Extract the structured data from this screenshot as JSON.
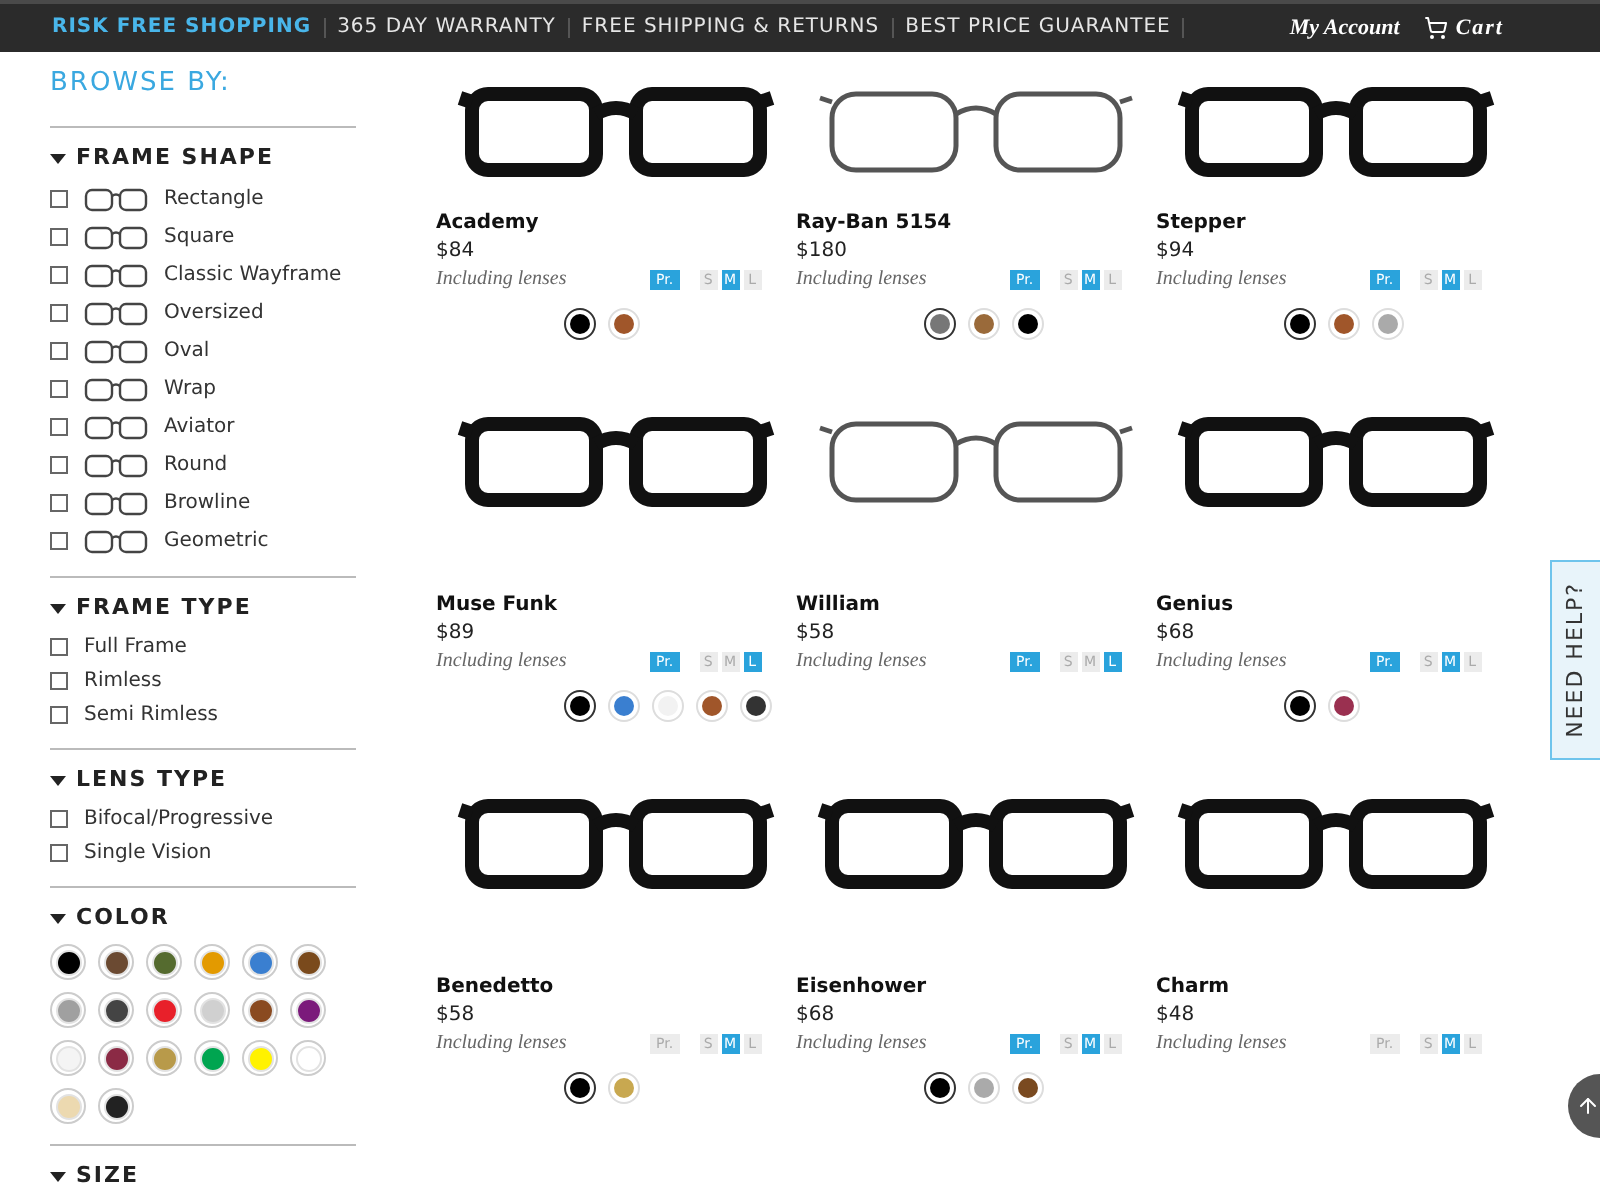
{
  "top_bar": {
    "promos": [
      {
        "label": "RISK FREE SHOPPING",
        "highlight": true
      },
      {
        "label": "365 DAY WARRANTY",
        "highlight": false
      },
      {
        "label": "FREE SHIPPING & RETURNS",
        "highlight": false
      },
      {
        "label": "BEST PRICE GUARANTEE",
        "highlight": false
      }
    ],
    "account": "My Account",
    "cart": "Cart"
  },
  "sidebar": {
    "title": "BROWSE BY:",
    "sections": [
      {
        "title": "FRAME SHAPE",
        "expanded": true,
        "kind": "shapes",
        "options": [
          {
            "label": "Rectangle",
            "checked": false
          },
          {
            "label": "Square",
            "checked": false
          },
          {
            "label": "Classic Wayframe",
            "checked": false
          },
          {
            "label": "Oversized",
            "checked": false
          },
          {
            "label": "Oval",
            "checked": false
          },
          {
            "label": "Wrap",
            "checked": false
          },
          {
            "label": "Aviator",
            "checked": false
          },
          {
            "label": "Round",
            "checked": false
          },
          {
            "label": "Browline",
            "checked": false
          },
          {
            "label": "Geometric",
            "checked": false
          }
        ]
      },
      {
        "title": "FRAME TYPE",
        "expanded": true,
        "kind": "checks",
        "options": [
          {
            "label": "Full Frame",
            "checked": false
          },
          {
            "label": "Rimless",
            "checked": false
          },
          {
            "label": "Semi Rimless",
            "checked": false
          }
        ]
      },
      {
        "title": "LENS TYPE",
        "expanded": true,
        "kind": "checks",
        "options": [
          {
            "label": "Bifocal/Progressive",
            "checked": false
          },
          {
            "label": "Single Vision",
            "checked": false
          }
        ]
      },
      {
        "title": "COLOR",
        "expanded": true,
        "kind": "colors",
        "options": [
          {
            "color": "#000000"
          },
          {
            "color": "#6b4a32"
          },
          {
            "color": "#556b2f"
          },
          {
            "color": "#e39a00"
          },
          {
            "color": "#3a7fd0"
          },
          {
            "color": "#7a4a1c"
          },
          {
            "color": "#a0a0a0"
          },
          {
            "color": "#444444"
          },
          {
            "color": "#e8202a"
          },
          {
            "color": "#d0d0d0"
          },
          {
            "color": "#8a4a20"
          },
          {
            "color": "#7b1a7b"
          },
          {
            "color": "#f4f4f4"
          },
          {
            "color": "#8b2a45"
          },
          {
            "color": "#b89a4a"
          },
          {
            "color": "#00a550"
          },
          {
            "color": "#fff200"
          },
          {
            "color": "#ffffff"
          },
          {
            "color": "#ecd9b0"
          },
          {
            "color": "#222222"
          }
        ]
      },
      {
        "title": "SIZE",
        "expanded": true,
        "kind": "checks"
      }
    ]
  },
  "products": [
    {
      "name": "Academy",
      "price": "$84",
      "note": "Including lenses",
      "progressive": "Pr.",
      "progressive_available": true,
      "sizes": [
        {
          "label": "S",
          "selected": false
        },
        {
          "label": "M",
          "selected": true
        },
        {
          "label": "L",
          "selected": false
        }
      ],
      "swatches": [
        {
          "color": "#000000",
          "selected": true
        },
        {
          "color": "#a0562a",
          "selected": false
        }
      ]
    },
    {
      "name": "Ray-Ban 5154",
      "price": "$180",
      "note": "Including lenses",
      "progressive": "Pr.",
      "progressive_available": true,
      "sizes": [
        {
          "label": "S",
          "selected": false
        },
        {
          "label": "M",
          "selected": true
        },
        {
          "label": "L",
          "selected": false
        }
      ],
      "swatches": [
        {
          "color": "#777777",
          "selected": true
        },
        {
          "color": "#9a6a3a",
          "selected": false
        },
        {
          "color": "#000000",
          "selected": false
        }
      ]
    },
    {
      "name": "Stepper",
      "price": "$94",
      "note": "Including lenses",
      "progressive": "Pr.",
      "progressive_available": true,
      "sizes": [
        {
          "label": "S",
          "selected": false
        },
        {
          "label": "M",
          "selected": true
        },
        {
          "label": "L",
          "selected": false
        }
      ],
      "swatches": [
        {
          "color": "#000000",
          "selected": true
        },
        {
          "color": "#a0562a",
          "selected": false
        },
        {
          "color": "#aaaaaa",
          "selected": false
        }
      ]
    },
    {
      "name": "Muse Funk",
      "price": "$89",
      "note": "Including lenses",
      "progressive": "Pr.",
      "progressive_available": true,
      "sizes": [
        {
          "label": "S",
          "selected": false
        },
        {
          "label": "M",
          "selected": false
        },
        {
          "label": "L",
          "selected": true
        }
      ],
      "swatches": [
        {
          "color": "#000000",
          "selected": true
        },
        {
          "color": "#3a7fd0",
          "selected": false
        },
        {
          "color": "#f2f2f2",
          "selected": false
        },
        {
          "color": "#a0562a",
          "selected": false
        },
        {
          "color": "#333333",
          "selected": false
        }
      ]
    },
    {
      "name": "William",
      "price": "$58",
      "note": "Including lenses",
      "progressive": "Pr.",
      "progressive_available": true,
      "sizes": [
        {
          "label": "S",
          "selected": false
        },
        {
          "label": "M",
          "selected": false
        },
        {
          "label": "L",
          "selected": true
        }
      ]
    },
    {
      "name": "Genius",
      "price": "$68",
      "note": "Including lenses",
      "progressive": "Pr.",
      "progressive_available": true,
      "sizes": [
        {
          "label": "S",
          "selected": false
        },
        {
          "label": "M",
          "selected": true
        },
        {
          "label": "L",
          "selected": false
        }
      ],
      "swatches": [
        {
          "color": "#000000",
          "selected": true
        },
        {
          "color": "#9a3050",
          "selected": false
        }
      ]
    },
    {
      "name": "Benedetto",
      "price": "$58",
      "note": "Including lenses",
      "progressive": "Pr.",
      "progressive_available": false,
      "sizes": [
        {
          "label": "S",
          "selected": false
        },
        {
          "label": "M",
          "selected": true
        },
        {
          "label": "L",
          "selected": false
        }
      ],
      "swatches": [
        {
          "color": "#000000",
          "selected": true
        },
        {
          "color": "#c8a850",
          "selected": false
        }
      ]
    },
    {
      "name": "Eisenhower",
      "price": "$68",
      "note": "Including lenses",
      "progressive": "Pr.",
      "progressive_available": true,
      "sizes": [
        {
          "label": "S",
          "selected": false
        },
        {
          "label": "M",
          "selected": true
        },
        {
          "label": "L",
          "selected": false
        }
      ],
      "swatches": [
        {
          "color": "#000000",
          "selected": true
        },
        {
          "color": "#aaaaaa",
          "selected": false
        },
        {
          "color": "#7a4a20",
          "selected": false
        }
      ]
    },
    {
      "name": "Charm",
      "price": "$48",
      "note": "Including lenses",
      "progressive": "Pr.",
      "progressive_available": false,
      "sizes": [
        {
          "label": "S",
          "selected": false
        },
        {
          "label": "M",
          "selected": true
        },
        {
          "label": "L",
          "selected": false
        }
      ]
    }
  ],
  "help_tab": "NEED HELP?"
}
